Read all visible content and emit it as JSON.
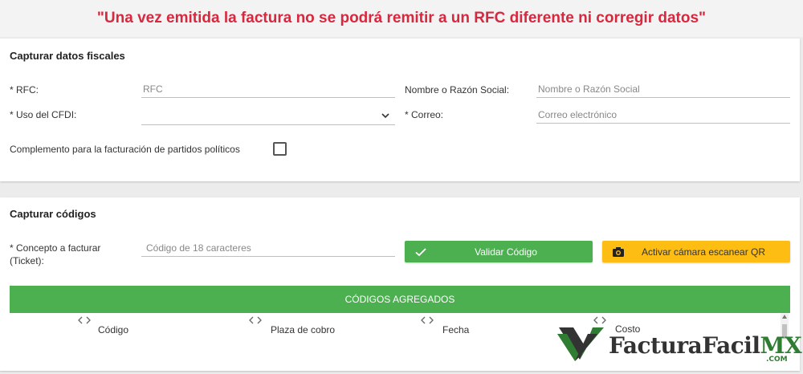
{
  "warning": "\"Una vez emitida la factura no se podrá remitir a un RFC diferente ni corregir datos\"",
  "fiscal": {
    "title": "Capturar datos fiscales",
    "rfc_label": "* RFC:",
    "rfc_placeholder": "RFC",
    "razon_label": "Nombre o Razón Social:",
    "razon_placeholder": "Nombre o Razón Social",
    "uso_label": "* Uso del CFDI:",
    "uso_value": "",
    "correo_label": "* Correo:",
    "correo_placeholder": "Correo electrónico",
    "complemento_label": "Complemento para la facturación de partidos políticos",
    "complemento_checked": false
  },
  "codes": {
    "title": "Capturar códigos",
    "concepto_label_line1": "* Concepto a facturar",
    "concepto_label_line2": "(Ticket):",
    "codigo_placeholder": "Código de 18 caracteres",
    "validate_button": "Validar Código",
    "camera_button": "Activar cámara escanear QR",
    "table_header": "CÓDIGOS AGREGADOS",
    "columns": [
      "Código",
      "Plaza de cobro",
      "Fecha",
      "Costo"
    ]
  },
  "logo": {
    "main": "FacturaFacil",
    "suffix": "MX",
    "domain": ".COM"
  },
  "colors": {
    "warning": "#d6283e",
    "success": "#4caf50",
    "camera": "#fdbd13",
    "brand_green": "#2e7d32"
  },
  "icons": {
    "validate": "check-icon",
    "camera": "camera-icon",
    "sort": "sort-arrows-icon",
    "select": "chevron-down-icon"
  }
}
